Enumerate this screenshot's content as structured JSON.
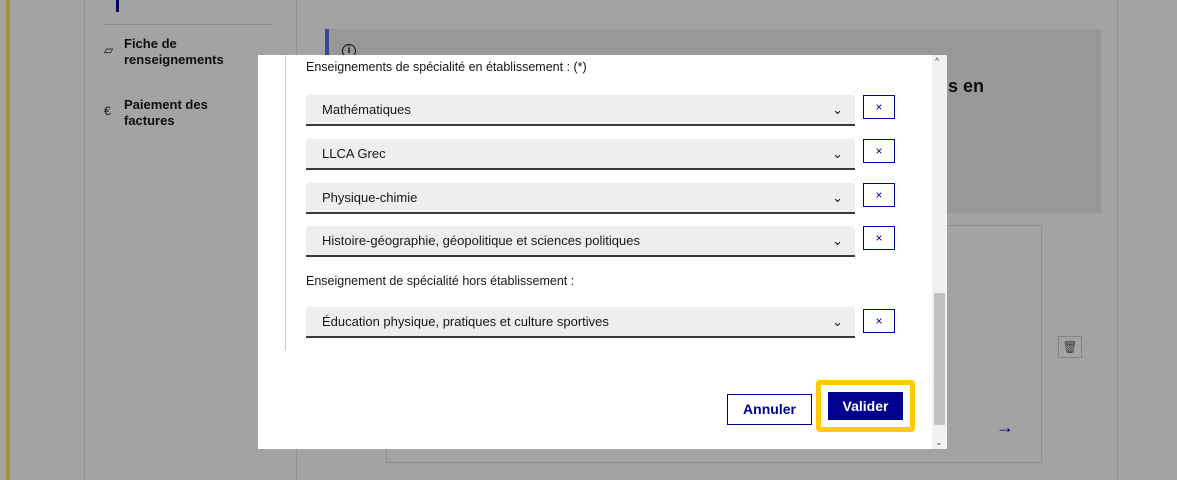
{
  "sidebar": {
    "items": [
      {
        "label_line1": "Fiche de",
        "label_line2": "renseignements",
        "icon": "file-icon"
      },
      {
        "label_line1": "Paiement des",
        "label_line2": "factures",
        "icon": "euro-icon"
      }
    ]
  },
  "background": {
    "info_icon": "i",
    "info_title_fragment": "s en",
    "card_arrow": "→",
    "trash_icon": "🗑"
  },
  "modal": {
    "in_school_label": "Enseignements de spécialité en établissement : (*)",
    "in_school_selects": [
      {
        "value": "Mathématiques"
      },
      {
        "value": "LLCA Grec"
      },
      {
        "value": "Physique-chimie"
      },
      {
        "value": "Histoire-géographie, géopolitique et sciences politiques"
      }
    ],
    "out_school_label": "Enseignement de spécialité hors établissement :",
    "out_school_selects": [
      {
        "value": "Éducation physique, pratiques et culture sportives"
      }
    ],
    "remove_glyph": "×",
    "chevron_glyph": "⌄",
    "cancel_label": "Annuler",
    "validate_label": "Valider",
    "scroll_up_glyph": "^",
    "scroll_down_glyph": "⌄"
  },
  "colors": {
    "primary": "#000091",
    "highlight": "#ffcb00",
    "rail": "#ffe552"
  }
}
